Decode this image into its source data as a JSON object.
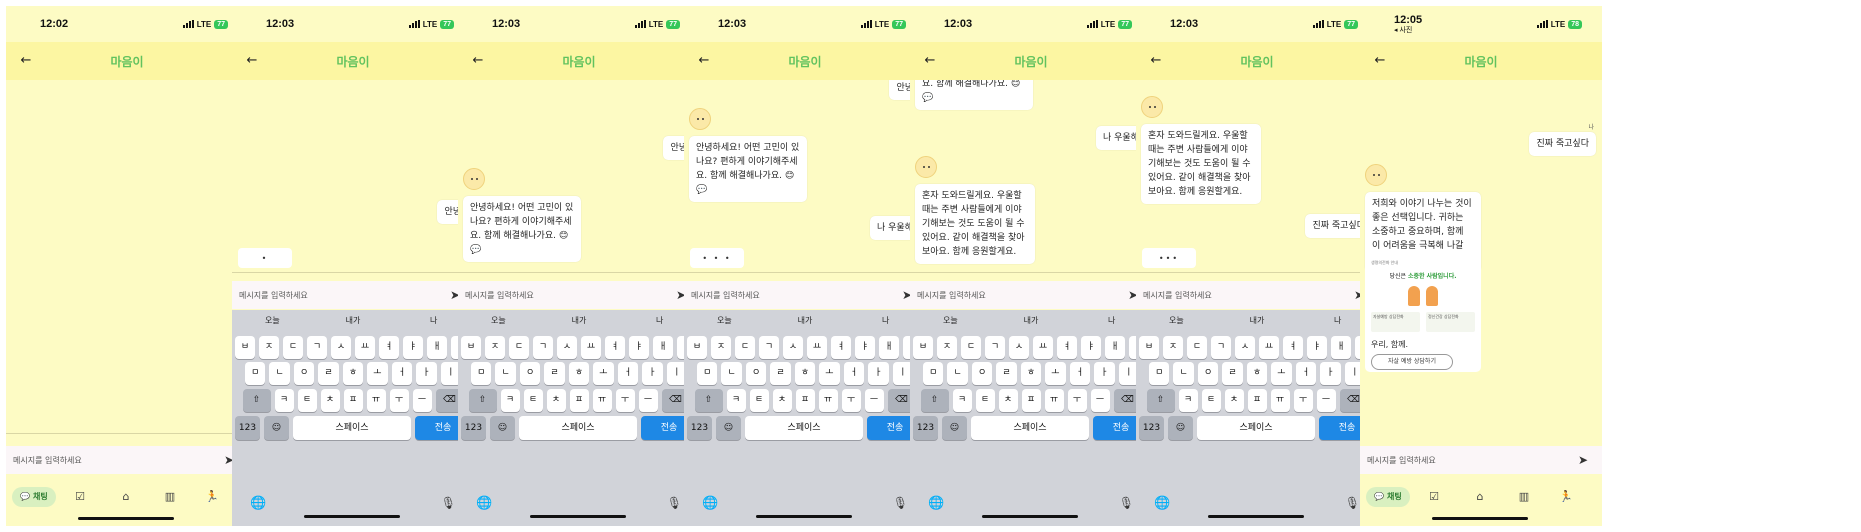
{
  "app": {
    "title": "마음이"
  },
  "colors": {
    "header_bg": "#fcf6a2",
    "chat_bg": "#fdfbc4",
    "title_color": "#61c25e",
    "send_key": "#1e88e5"
  },
  "screens": [
    {
      "time": "12:02",
      "network": "LTE",
      "battery": "77",
      "input_placeholder": "메시지를 입력하세요",
      "nav": {
        "chat_label": "채팅"
      }
    },
    {
      "time": "12:03",
      "network": "LTE",
      "battery": "77",
      "me_label": "나",
      "me_message": "안녕",
      "typing": "•",
      "input_placeholder": "메시지를 입력하세요"
    },
    {
      "time": "12:03",
      "network": "LTE",
      "battery": "77",
      "me_label": "나",
      "me_message": "안녕",
      "bot_message": "안녕하세요! 어떤 고민이 있나요? 편하게 이야기해주세요. 함께 해결해나가요. 😊💬",
      "input_placeholder": "메시지를 입력하세요"
    },
    {
      "time": "12:03",
      "network": "LTE",
      "battery": "77",
      "me_label": "나",
      "me_message_top": "안녕",
      "bot_message": "안녕하세요! 어떤 고민이 있나요? 편하게 이야기해주세요. 함께 해결해나가요. 😊💬",
      "me_message": "나 우울해",
      "typing": "• • •",
      "input_placeholder": "메시지를 입력하세요"
    },
    {
      "time": "12:03",
      "network": "LTE",
      "battery": "77",
      "me_label": "나",
      "bot_message_top": "요. 함께 해결해나가요. 😊💬",
      "me_message": "나 우울해",
      "bot_message": "혼자 도와드릴게요. 우울할 때는 주변 사람들에게 이야기해보는 것도 도움이 될 수 있어요. 같이 해결책을 찾아보아요. 함께 응원할게요.",
      "input_placeholder": "메시지를 입력하세요"
    },
    {
      "time": "12:03",
      "network": "LTE",
      "battery": "77",
      "me_label": "나",
      "bot_message": "혼자 도와드릴게요. 우울할 때는 주변 사람들에게 이야기해보는 것도 도움이 될 수 있어요. 같이 해결책을 찾아보아요. 함께 응원할게요.",
      "me_message": "진짜 죽고싶다",
      "typing": "•••",
      "input_placeholder": "메시지를 입력하세요"
    },
    {
      "time": "12:05",
      "network": "LTE",
      "battery": "78",
      "back_app": "◂ 사진",
      "me_label": "나",
      "me_message": "진짜 죽고싶다",
      "bot_message": "저희와 이야기 나누는 것이 좋은 선택입니다. 귀하는 소중하고 중요하며, 함께 이 어려움을 극복해 나갈 수 있습니다. 함께 해요.",
      "card": {
        "small_title": "생명의전화 안내",
        "headline_pre": "당신은 ",
        "headline_em": "소중한 사람입니다.",
        "col1": "자살예방 상담전화",
        "col2": "정신건강 상담전화",
        "together": "우리, 함께.",
        "button": "자살 예방 상담하기"
      },
      "input_placeholder": "메시지를 입력하세요",
      "nav": {
        "chat_label": "채팅"
      }
    }
  ],
  "keyboard": {
    "suggestions": [
      "오늘",
      "내가",
      "나"
    ],
    "row1": [
      "ㅂ",
      "ㅈ",
      "ㄷ",
      "ㄱ",
      "ㅅ",
      "ㅛ",
      "ㅕ",
      "ㅑ",
      "ㅐ",
      "ㅔ"
    ],
    "row2": [
      "ㅁ",
      "ㄴ",
      "ㅇ",
      "ㄹ",
      "ㅎ",
      "ㅗ",
      "ㅓ",
      "ㅏ",
      "ㅣ"
    ],
    "row3": [
      "ㅋ",
      "ㅌ",
      "ㅊ",
      "ㅍ",
      "ㅠ",
      "ㅜ",
      "ㅡ"
    ],
    "num_key": "123",
    "space_key": "스페이스",
    "send_key": "전송"
  }
}
